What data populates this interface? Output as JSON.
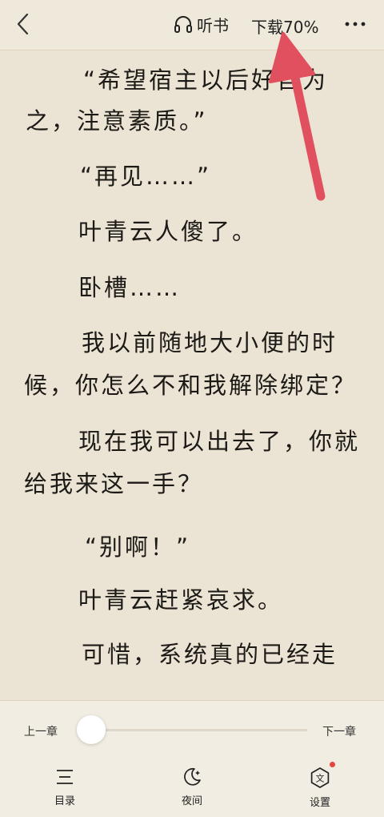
{
  "header": {
    "back_icon": "chevron-left-icon",
    "listen_icon": "headphones-icon",
    "listen_label": "听书",
    "download_label": "下载70%",
    "download_progress": 0.7,
    "more_icon": "more-dots-icon",
    "annotation_color": "#e0505f"
  },
  "content": {
    "paragraphs": [
      "“希望宿主以后好自为",
      "之，注意素质。”",
      "“再见……”",
      "叶青云人傻了。",
      "卧槽……",
      "我以前随地大小便的时",
      "候，你怎么不和我解除绑定？",
      "现在我可以出去了，你就",
      "给我来这一手？",
      "“别啊！”",
      "叶青云赶紧哀求。",
      "可惜，系统真的已经走"
    ]
  },
  "progress": {
    "prev_label": "上一章",
    "next_label": "下一章",
    "value": 0
  },
  "nav": {
    "catalog_label": "目录",
    "catalog_icon": "menu-lines-icon",
    "night_label": "夜间",
    "night_icon": "moon-icon",
    "settings_label": "设置",
    "settings_icon": "text-settings-icon",
    "badge_color": "#e5463f"
  }
}
